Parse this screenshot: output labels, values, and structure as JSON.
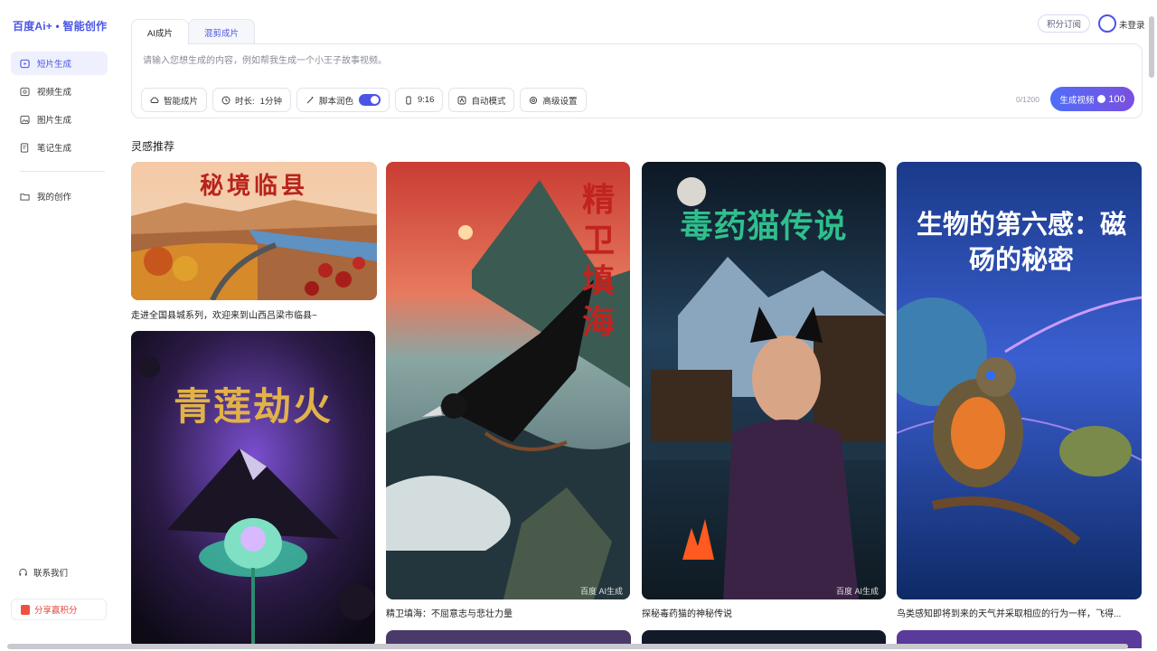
{
  "brand": {
    "logo": "百度Ai+ • 智能创作",
    "accent": "#4a55e6"
  },
  "sidebar": {
    "items": [
      {
        "label": "短片生成",
        "icon": "film-icon",
        "active": true
      },
      {
        "label": "视频生成",
        "icon": "video-icon",
        "active": false
      },
      {
        "label": "图片生成",
        "icon": "image-icon",
        "active": false
      },
      {
        "label": "笔记生成",
        "icon": "note-icon",
        "active": false
      }
    ],
    "my_works": "我的创作",
    "contact": "联系我们",
    "share": "分享赢积分"
  },
  "header": {
    "subscribe": "积分订阅",
    "login": "未登录"
  },
  "composer": {
    "tabs": [
      "AI成片",
      "混剪成片"
    ],
    "placeholder": "请输入您想生成的内容，例如帮我生成一个小王子故事视频。",
    "chips": {
      "smart": "智能成片",
      "duration_label": "时长:",
      "duration_value": "1分钟",
      "script": "脚本润色",
      "ratio": "9:16",
      "auto": "自动模式",
      "advanced": "高级设置"
    },
    "script_polish_on": true,
    "counter": "0/1200",
    "generate_label": "生成视频",
    "generate_cost": "100"
  },
  "inspiration": {
    "title": "灵感推荐",
    "cards": [
      {
        "image_title": "秘境临县",
        "caption": "走进全国县城系列，欢迎来到山西吕梁市临县~"
      },
      {
        "image_title": "青莲劫火",
        "caption": ""
      },
      {
        "image_title": "精卫填海",
        "caption": "精卫填海：不屈意志与悲壮力量",
        "watermark": "百度 AI生成"
      },
      {
        "image_title": "毒药猫传说",
        "caption": "探秘毒药猫的神秘传说",
        "watermark": "百度 AI生成"
      },
      {
        "image_title": "生物的第六感：磁砀的秘密",
        "caption": "鸟类感知即将到来的天气并采取相应的行为一样，飞得..."
      }
    ]
  }
}
